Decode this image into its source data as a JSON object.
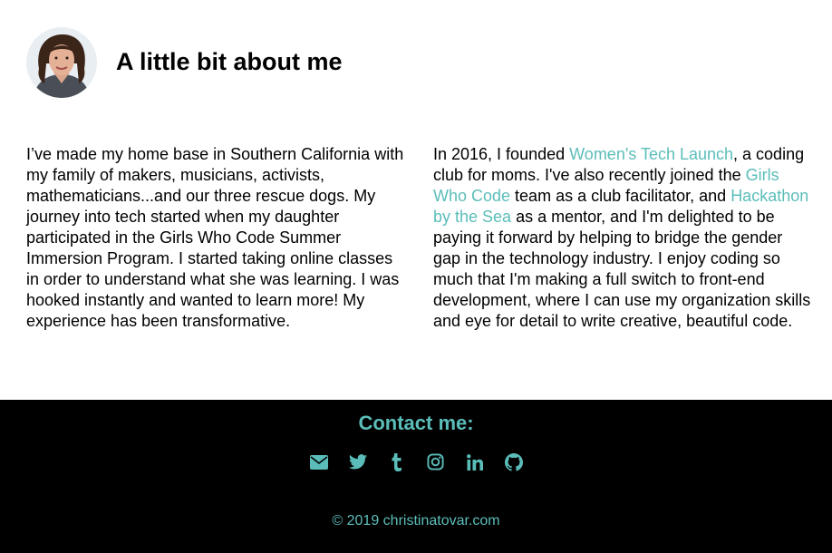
{
  "header": {
    "title": "A little bit about me"
  },
  "about": {
    "left_paragraph": "I’ve made my home base in Southern California with my family of makers, musicians, activists, mathematicians...and our three rescue dogs. My journey into tech started when my daughter participated in the Girls Who Code Summer Immersion Program. I started taking online classes in order to understand what she was learning. I was hooked instantly and wanted to learn more! My experience has been transformative.",
    "right": {
      "part1": "In 2016, I founded ",
      "link1": "Women's Tech Launch",
      "part2": ", a coding club for moms. I've also recently joined the ",
      "link2": "Girls Who Code",
      "part3": " team as a club facilitator, and ",
      "link3": "Hackathon by the Sea",
      "part4": " as a mentor, and I'm delighted to be paying it forward by helping to bridge the gender gap in the technology industry. I enjoy coding so much that I'm making a full switch to front-end development, where I can use my organization skills and eye for detail to write creative, beautiful code."
    }
  },
  "footer": {
    "contact_title": "Contact me:",
    "icons": [
      "envelope-icon",
      "twitter-icon",
      "tumblr-icon",
      "instagram-icon",
      "linkedin-icon",
      "github-icon"
    ],
    "copyright": "© 2019 christinatovar.com"
  },
  "colors": {
    "accent": "#5bbdb9",
    "footer_bg": "#000000",
    "background": "#ffffff",
    "text": "#000000"
  }
}
